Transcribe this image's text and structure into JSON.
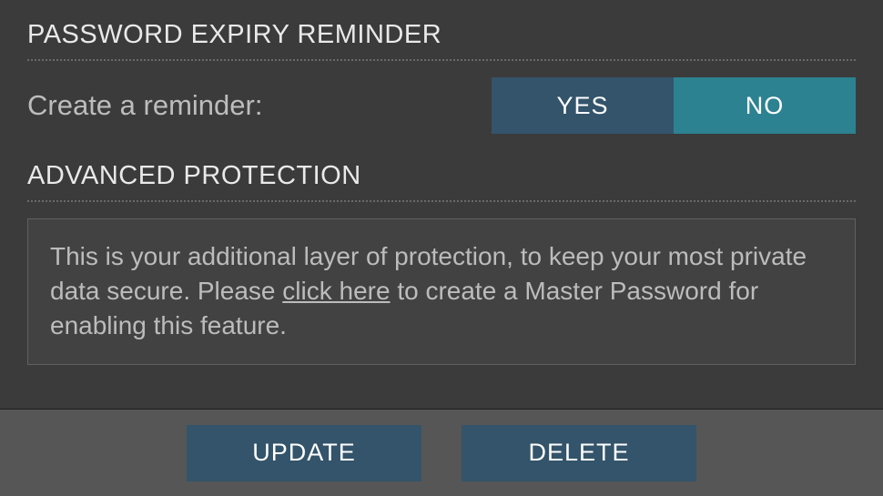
{
  "sections": {
    "expiry": {
      "title": "PASSWORD EXPIRY REMINDER",
      "row_label": "Create a reminder:",
      "toggle": {
        "yes": "YES",
        "no": "NO",
        "selected": "no"
      }
    },
    "advanced": {
      "title": "ADVANCED PROTECTION",
      "info_pre": "This is your additional layer of protection, to keep your most private data secure. Please ",
      "info_link": "click here",
      "info_post": " to create a Master Password for enabling this feature."
    }
  },
  "footer": {
    "update": "UPDATE",
    "delete": "DELETE"
  },
  "colors": {
    "bg": "#3b3b3b",
    "footer_bg": "#565656",
    "button_bg": "#33546a",
    "toggle_active": "#2c8291",
    "text": "#d9d9d9"
  }
}
